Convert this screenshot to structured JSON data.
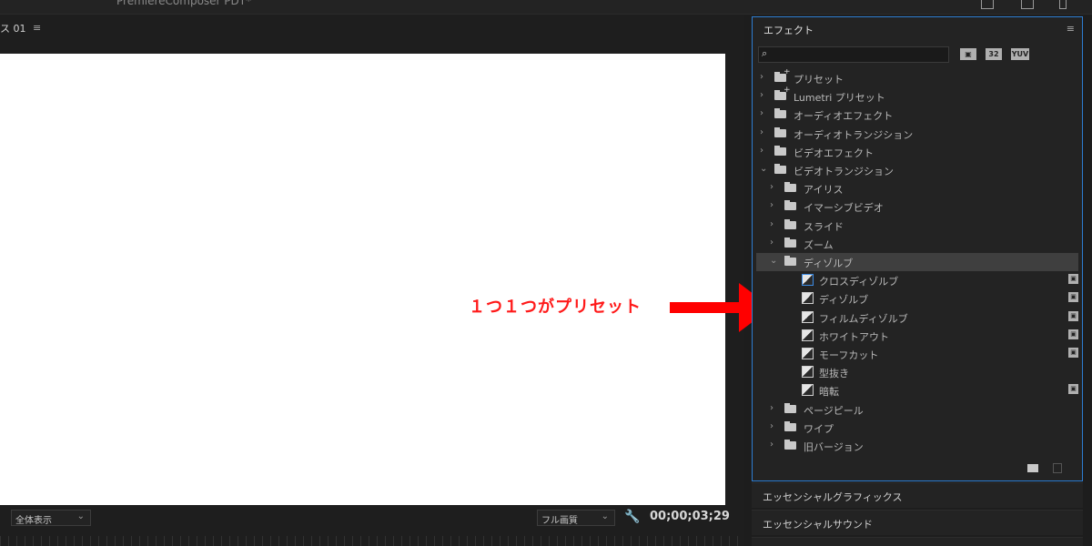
{
  "topbar": {
    "title": "PremiereComposer PDT*"
  },
  "monitor": {
    "tab_label": "ス 01",
    "fit_label": "全体表示",
    "quality_label": "フル画質",
    "timecode": "00;00;03;29"
  },
  "annotation": {
    "text": "１つ１つがプリセット",
    "color": "#ff1a1a"
  },
  "effects": {
    "title": "エフェクト",
    "search_placeholder": "",
    "badges": [
      "32",
      "YUV"
    ],
    "tree": [
      {
        "label": "プリセット",
        "type": "star-folder",
        "depth": 0,
        "expanded": false
      },
      {
        "label": "Lumetri プリセット",
        "type": "star-folder",
        "depth": 0,
        "expanded": false
      },
      {
        "label": "オーディオエフェクト",
        "type": "folder",
        "depth": 0,
        "expanded": false
      },
      {
        "label": "オーディオトランジション",
        "type": "folder",
        "depth": 0,
        "expanded": false
      },
      {
        "label": "ビデオエフェクト",
        "type": "folder",
        "depth": 0,
        "expanded": false
      },
      {
        "label": "ビデオトランジション",
        "type": "folder",
        "depth": 0,
        "expanded": true
      },
      {
        "label": "アイリス",
        "type": "folder",
        "depth": 1,
        "expanded": false
      },
      {
        "label": "イマーシブビデオ",
        "type": "folder",
        "depth": 1,
        "expanded": false
      },
      {
        "label": "スライド",
        "type": "folder",
        "depth": 1,
        "expanded": false
      },
      {
        "label": "ズーム",
        "type": "folder",
        "depth": 1,
        "expanded": false
      },
      {
        "label": "ディゾルブ",
        "type": "folder",
        "depth": 1,
        "expanded": true,
        "selected": true
      },
      {
        "label": "クロスディゾルブ",
        "type": "effect",
        "depth": 2,
        "highlight": true,
        "accel": true
      },
      {
        "label": "ディゾルブ",
        "type": "effect",
        "depth": 2,
        "accel": true
      },
      {
        "label": "フィルムディゾルブ",
        "type": "effect",
        "depth": 2,
        "accel": true
      },
      {
        "label": "ホワイトアウト",
        "type": "effect",
        "depth": 2,
        "accel": true
      },
      {
        "label": "モーフカット",
        "type": "effect",
        "depth": 2,
        "accel": true
      },
      {
        "label": "型抜き",
        "type": "effect",
        "depth": 2,
        "accel": false
      },
      {
        "label": "暗転",
        "type": "effect",
        "depth": 2,
        "accel": true
      },
      {
        "label": "ページピール",
        "type": "folder",
        "depth": 1,
        "expanded": false
      },
      {
        "label": "ワイプ",
        "type": "folder",
        "depth": 1,
        "expanded": false
      },
      {
        "label": "旧バージョン",
        "type": "folder",
        "depth": 1,
        "expanded": false
      }
    ]
  },
  "lower_panels": {
    "essential_graphics": "エッセンシャルグラフィックス",
    "essential_sound": "エッセンシャルサウンド"
  },
  "colors": {
    "panel_focus_border": "#2d7dd2",
    "background": "#1d1d1d"
  }
}
